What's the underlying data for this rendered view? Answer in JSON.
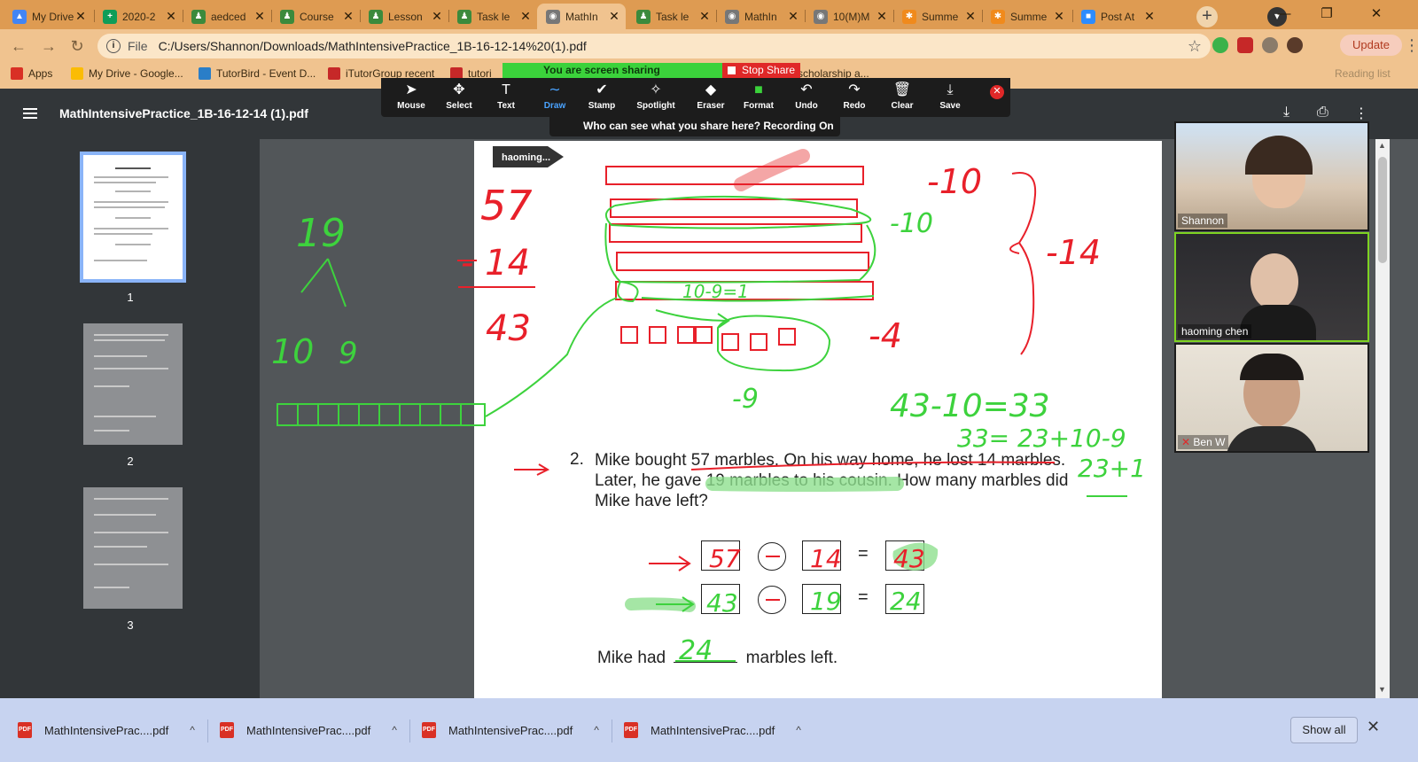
{
  "tabs": [
    {
      "title": "My Drive",
      "color": "#4285f4",
      "glyph": "▲"
    },
    {
      "title": "2020-2",
      "color": "#0f9d58",
      "glyph": "+"
    },
    {
      "title": "aedced",
      "color": "#3c8a3c",
      "glyph": "♟"
    },
    {
      "title": "Course",
      "color": "#3c8a3c",
      "glyph": "♟"
    },
    {
      "title": "Lesson",
      "color": "#3c8a3c",
      "glyph": "♟"
    },
    {
      "title": "Task le",
      "color": "#3c8a3c",
      "glyph": "♟"
    },
    {
      "title": "MathIn",
      "color": "#777777",
      "glyph": "◉"
    },
    {
      "title": "Task le",
      "color": "#3c8a3c",
      "glyph": "♟"
    },
    {
      "title": "MathIn",
      "color": "#777777",
      "glyph": "◉"
    },
    {
      "title": "10(M)M",
      "color": "#777777",
      "glyph": "◉"
    },
    {
      "title": "Summe",
      "color": "#f08a1c",
      "glyph": "✱"
    },
    {
      "title": "Summe",
      "color": "#f08a1c",
      "glyph": "✱"
    },
    {
      "title": "Post At",
      "color": "#2d8cff",
      "glyph": "■"
    }
  ],
  "address": {
    "file_label": "File",
    "url": "C:/Users/Shannon/Downloads/MathIntensivePractice_1B-16-12-14%20(1).pdf",
    "update_label": "Update"
  },
  "bookmarks": [
    {
      "label": "Apps",
      "color": "#d93025"
    },
    {
      "label": "My Drive - Google...",
      "color": "#fbbc04"
    },
    {
      "label": "TutorBird - Event D...",
      "color": "#2a7ec8"
    },
    {
      "label": "iTutorGroup recent",
      "color": "#c62828"
    },
    {
      "label": "tutori",
      "color": "#c62828"
    },
    {
      "label": "scholarship a...",
      "color": "#f0c38f"
    }
  ],
  "reading_list": "Reading list",
  "zoom": {
    "sharing_label": "You are screen sharing",
    "stop_share_label": "Stop Share",
    "who_can_see": "Who can see what you share here? Recording On",
    "annotator": "haoming...",
    "tools": [
      {
        "label": "Mouse",
        "icon": "➤"
      },
      {
        "label": "Select",
        "icon": "✥"
      },
      {
        "label": "Text",
        "icon": "T"
      },
      {
        "label": "Draw",
        "icon": "∼"
      },
      {
        "label": "Stamp",
        "icon": "✔"
      },
      {
        "label": "Spotlight",
        "icon": "✧"
      },
      {
        "label": "Eraser",
        "icon": "◆"
      },
      {
        "label": "Format",
        "icon": "■"
      },
      {
        "label": "Undo",
        "icon": "↶"
      },
      {
        "label": "Redo",
        "icon": "↷"
      },
      {
        "label": "Clear",
        "icon": "🗑"
      },
      {
        "label": "Save",
        "icon": "⤓"
      }
    ],
    "active_tool": "Draw",
    "format_color": "#3bd23b",
    "participants": [
      {
        "name": "Shannon",
        "muted": false
      },
      {
        "name": "haoming   chen",
        "muted": false
      },
      {
        "name": "Ben W",
        "muted": true
      }
    ]
  },
  "pdf": {
    "title": "MathIntensivePractice_1B-16-12-14 (1).pdf",
    "pages": [
      "1",
      "2",
      "3"
    ],
    "question_number": "2.",
    "question": "Mike bought 57 marbles. On his way home, he lost 14 marbles. Later, he gave 19 marbles to his cousin. How many marbles did Mike have left?",
    "equal_sign": "=",
    "answer_prefix": "Mike had",
    "answer_suffix": "marbles left."
  },
  "downloads": {
    "items": [
      "MathIntensivePrac....pdf",
      "MathIntensivePrac....pdf",
      "MathIntensivePrac....pdf",
      "MathIntensivePrac....pdf"
    ],
    "show_all_label": "Show all"
  },
  "annotations": {
    "left_column": [
      "19",
      "10",
      "9"
    ],
    "subtraction": [
      "57",
      "- 14",
      "43"
    ],
    "bar_labels": [
      "-10",
      "-10",
      "-14",
      "-4",
      "-9",
      "10-9=1"
    ],
    "work": [
      "43-10=33",
      "33= 23+10-9",
      "23+1"
    ],
    "equation_1": [
      "57",
      "14",
      "43"
    ],
    "equation_2": [
      "43",
      "19",
      "24"
    ],
    "answer": "24"
  },
  "colors": {
    "ink_red": "#e8202a",
    "ink_green": "#3dd23d",
    "highlight_green": "#8fe08f",
    "highlight_pink": "#f4a6a6"
  }
}
